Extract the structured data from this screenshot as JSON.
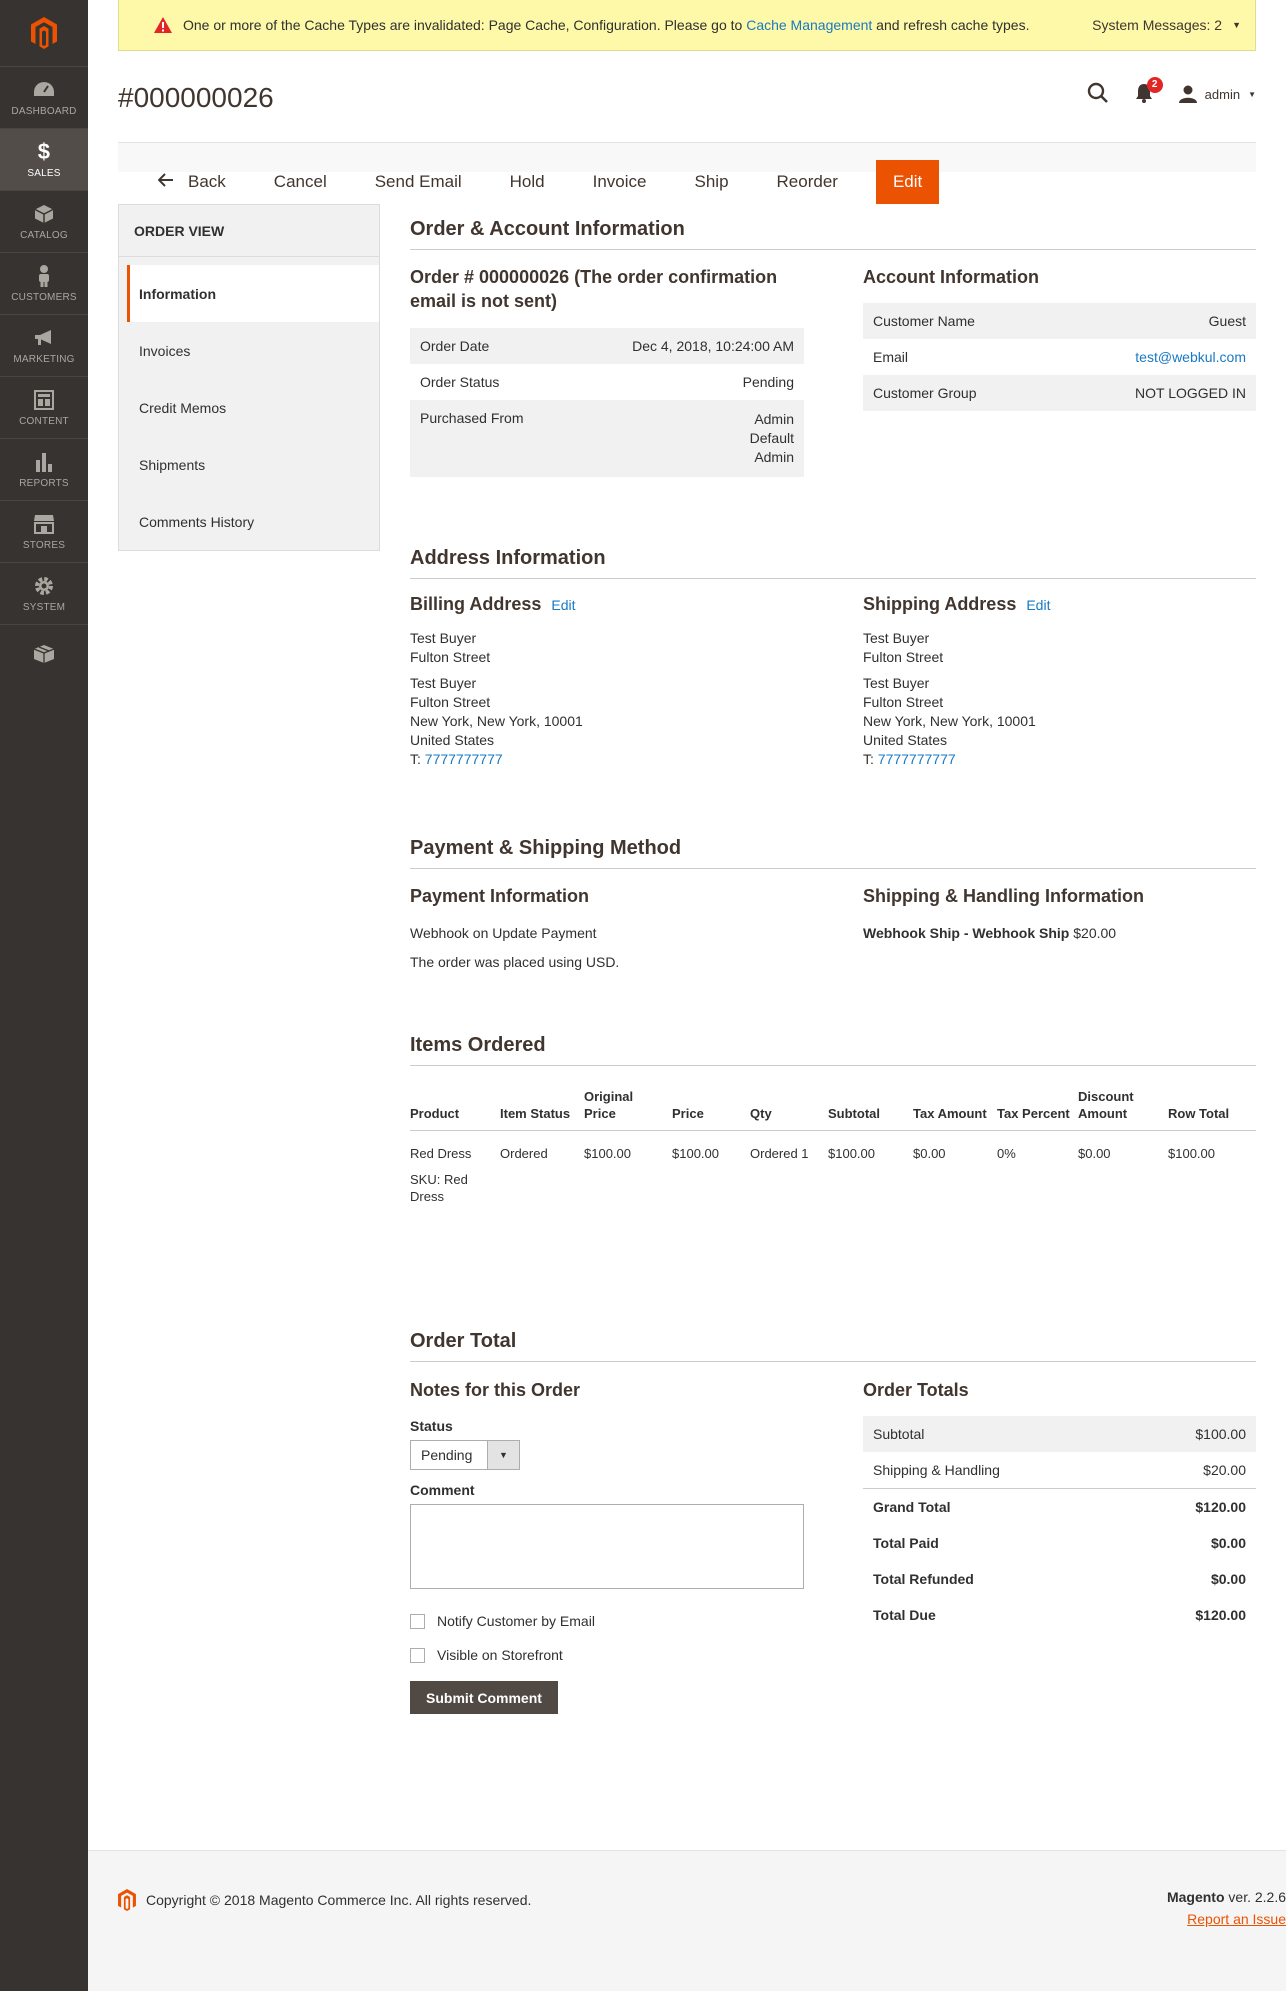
{
  "menu": {
    "items": [
      {
        "label": "DASHBOARD",
        "icon": "dashboard-icon"
      },
      {
        "label": "SALES",
        "icon": "dollar-icon"
      },
      {
        "label": "CATALOG",
        "icon": "cube-icon"
      },
      {
        "label": "CUSTOMERS",
        "icon": "person-icon"
      },
      {
        "label": "MARKETING",
        "icon": "megaphone-icon"
      },
      {
        "label": "CONTENT",
        "icon": "layout-icon"
      },
      {
        "label": "REPORTS",
        "icon": "bar-chart-icon"
      },
      {
        "label": "STORES",
        "icon": "store-icon"
      },
      {
        "label": "SYSTEM",
        "icon": "gear-icon"
      },
      {
        "label": "",
        "icon": "box-icon"
      }
    ]
  },
  "system_message": {
    "text_before": "One or more of the Cache Types are invalidated: Page Cache, Configuration. Please go to ",
    "link": "Cache Management",
    "text_after": " and refresh cache types.",
    "counter": "System Messages: 2"
  },
  "header": {
    "title": "#000000026",
    "notifications_count": "2",
    "user": "admin"
  },
  "toolbar": {
    "back": "Back",
    "cancel": "Cancel",
    "send_email": "Send Email",
    "hold": "Hold",
    "invoice": "Invoice",
    "ship": "Ship",
    "reorder": "Reorder",
    "edit": "Edit"
  },
  "side": {
    "heading": "ORDER VIEW",
    "tabs": [
      "Information",
      "Invoices",
      "Credit Memos",
      "Shipments",
      "Comments History"
    ]
  },
  "order_account": {
    "section_title": "Order & Account Information",
    "order_heading": "Order # 000000026 (The order confirmation email is not sent)",
    "order_rows": [
      {
        "k": "Order Date",
        "v": "Dec 4, 2018, 10:24:00 AM"
      },
      {
        "k": "Order Status",
        "v": "Pending"
      },
      {
        "k": "Purchased From",
        "v1": "Admin",
        "v2": "Default",
        "v3": "Admin"
      }
    ],
    "account_heading": "Account Information",
    "account_rows": [
      {
        "k": "Customer Name",
        "v": "Guest"
      },
      {
        "k": "Email",
        "v": "test@webkul.com"
      },
      {
        "k": "Customer Group",
        "v": "NOT LOGGED IN"
      }
    ]
  },
  "address": {
    "section_title": "Address Information",
    "billing": {
      "heading": "Billing Address",
      "edit": "Edit",
      "lines1": [
        "Test Buyer",
        "Fulton Street"
      ],
      "lines2": [
        "Test Buyer",
        "Fulton Street",
        "New York, New York, 10001",
        "United States"
      ],
      "phone_prefix": "T: ",
      "phone": "7777777777"
    },
    "shipping": {
      "heading": "Shipping Address",
      "edit": "Edit",
      "lines1": [
        "Test Buyer",
        "Fulton Street"
      ],
      "lines2": [
        "Test Buyer",
        "Fulton Street",
        "New York, New York, 10001",
        "United States"
      ],
      "phone_prefix": "T: ",
      "phone": "7777777777"
    }
  },
  "payment": {
    "section_title": "Payment & Shipping Method",
    "payment_heading": "Payment Information",
    "method": "Webhook on Update Payment",
    "currency_note": "The order was placed using USD.",
    "shipping_heading": "Shipping & Handling Information",
    "shipping_method": "Webhook Ship - Webhook Ship",
    "shipping_price": " $20.00"
  },
  "items": {
    "section_title": "Items Ordered",
    "columns": [
      "Product",
      "Item Status",
      "Original Price",
      "Price",
      "Qty",
      "Subtotal",
      "Tax Amount",
      "Tax Percent",
      "Discount Amount",
      "Row Total"
    ],
    "rows": [
      {
        "product": "Red Dress",
        "sku": "SKU: Red Dress",
        "status": "Ordered",
        "original_price": "$100.00",
        "price": "$100.00",
        "qty": "Ordered 1",
        "subtotal": "$100.00",
        "tax_amount": "$0.00",
        "tax_percent": "0%",
        "discount": "$0.00",
        "row_total": "$100.00"
      }
    ]
  },
  "order_total": {
    "section_title": "Order Total",
    "notes_heading": "Notes for this Order",
    "status_label": "Status",
    "status_value": "Pending",
    "comment_label": "Comment",
    "notify_label": "Notify Customer by Email",
    "visible_label": "Visible on Storefront",
    "submit": "Submit Comment",
    "totals_heading": "Order Totals",
    "totals": [
      {
        "k": "Subtotal",
        "v": "$100.00"
      },
      {
        "k": "Shipping & Handling",
        "v": "$20.00"
      },
      {
        "k": "Grand Total",
        "v": "$120.00"
      },
      {
        "k": "Total Paid",
        "v": "$0.00"
      },
      {
        "k": "Total Refunded",
        "v": "$0.00"
      },
      {
        "k": "Total Due",
        "v": "$120.00"
      }
    ]
  },
  "footer": {
    "copyright": "Copyright © 2018 Magento Commerce Inc. All rights reserved.",
    "brand": "Magento",
    "version": " ver. 2.2.6",
    "report": "Report an Issue"
  },
  "colors": {
    "accent": "#eb5202",
    "menu_bg": "#373330",
    "link": "#1979c3",
    "message_bg": "#fdf9a8"
  }
}
